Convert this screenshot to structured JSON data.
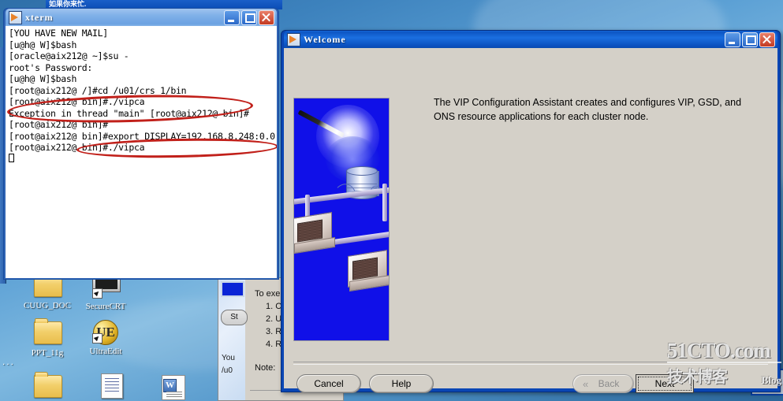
{
  "desktop": {
    "icons": [
      {
        "label": "CUUG_DOC",
        "type": "folder"
      },
      {
        "label": "SecureCRT",
        "type": "crt"
      },
      {
        "label": "PPT_11g",
        "type": "folder"
      },
      {
        "label": "UltraEdit",
        "type": "ultraedit",
        "glyph": "UE"
      }
    ],
    "ellipsis": "...",
    "top_strip_title": "如果你来忙."
  },
  "xterm": {
    "title": "xterm",
    "window_buttons": {
      "minimize": "_",
      "maximize": "□",
      "close": "✕"
    },
    "lines": [
      "[YOU HAVE NEW MAIL]",
      "[u@h@ W]$bash",
      "[oracle@aix212@ ~]$su -",
      "root's Password:",
      "[u@h@ W]$bash",
      "[root@aix212@ /]#cd /u01/crs_1/bin",
      "[root@aix212@ bin]#./vipca",
      "Exception in thread \"main\" [root@aix212@ bin]#",
      "[root@aix212@ bin]#",
      "[root@aix212@ bin]#export DISPLAY=192.168.8.248:0.0",
      "[root@aix212@ bin]#./vipca"
    ]
  },
  "background_window": {
    "body_lines": [
      "To exe",
      "1. C",
      "2. U",
      "3. R",
      "4. R"
    ],
    "note_label": "Note:",
    "left_lines": [
      "You",
      "/u0"
    ],
    "start_button": "St"
  },
  "welcome_dialog": {
    "title": "Welcome",
    "window_buttons": {
      "minimize": "_",
      "maximize": "□",
      "close": "✕"
    },
    "message": "The VIP Configuration Assistant creates and configures VIP, GSD, and ONS resource applications for each cluster node.",
    "buttons": {
      "cancel": "Cancel",
      "help": "Help",
      "back": "Back",
      "back_mnemonic": "B",
      "next": "Next",
      "next_mnemonic": "N",
      "back_chevron": "«"
    }
  },
  "watermark": {
    "main": "51CTO.com",
    "chinese": "技术博客",
    "blog": "Blog"
  },
  "colors": {
    "desktop_blue": "#3d82bd",
    "active_title": "#0d56c4",
    "inactive_title": "#7fb0e8",
    "dialog_face": "#d4d0c8",
    "terminal_bg": "#ffffff",
    "terminal_fg": "#000000",
    "annotation_red": "#c1201a",
    "splash_blue": "#1010e8"
  }
}
